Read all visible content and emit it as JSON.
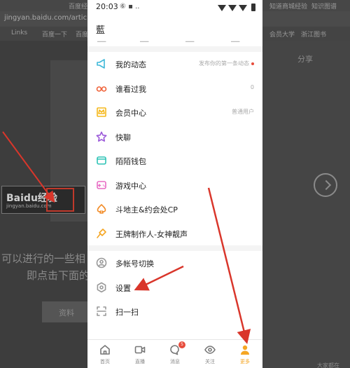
{
  "background_page": {
    "tabs": [
      "百度经验-让...",
      "知道商城经验",
      "知识图谱"
    ],
    "url": "jingyan.baidu.com/article/",
    "bookmarks": [
      "Links",
      "百度一下",
      "百度",
      "会员大学",
      "浙江图书"
    ],
    "logo_text": "Baidu经验",
    "logo_sub": "jingyan.baidu.com",
    "left_text_1": "可以进行的一些相",
    "left_text_2": "即点击下面的设",
    "bottom_left_text": "资料",
    "right_panel_text": "分享",
    "bottom_right_text": "大家都在"
  },
  "status_bar": {
    "time": "20:03",
    "left_icons": "⑥ ▪ .."
  },
  "profile": {
    "username": "藍"
  },
  "menu": [
    {
      "label": "我的动态",
      "extra": "发布你的第一条动态",
      "dot": true,
      "icon": "megaphone-icon",
      "color": "#3fb8d9"
    },
    {
      "label": "谁看过我",
      "extra": "0",
      "dot": false,
      "icon": "glasses-icon",
      "color": "#f0643c"
    },
    {
      "label": "会员中心",
      "extra": "普通用户",
      "dot": false,
      "icon": "crown-icon",
      "color": "#f5b81c"
    },
    {
      "label": "快聊",
      "extra": "",
      "dot": false,
      "icon": "star-icon",
      "color": "#9b59d9"
    },
    {
      "label": "陌陌钱包",
      "extra": "",
      "dot": false,
      "icon": "wallet-icon",
      "color": "#2ec4b6"
    },
    {
      "label": "游戏中心",
      "extra": "",
      "dot": false,
      "icon": "gamepad-icon",
      "color": "#e86cc4"
    },
    {
      "label": "斗地主&约会处CP",
      "extra": "",
      "dot": false,
      "icon": "spade-icon",
      "color": "#f28c28"
    },
    {
      "label": "王牌制作人-女神靓声",
      "extra": "",
      "dot": false,
      "icon": "microphone-icon",
      "color": "#f5a623"
    },
    {
      "label": "多帐号切换",
      "extra": "",
      "dot": false,
      "icon": "account-switch-icon",
      "color": "#999999"
    },
    {
      "label": "设置",
      "extra": "",
      "dot": false,
      "icon": "settings-hexagon-icon",
      "color": "#999999"
    },
    {
      "label": "扫一扫",
      "extra": "",
      "dot": false,
      "icon": "scan-icon",
      "color": "#999999"
    }
  ],
  "bottom_nav": [
    {
      "label": "首页",
      "icon": "home-icon",
      "active": false
    },
    {
      "label": "直播",
      "icon": "video-icon",
      "active": false
    },
    {
      "label": "消息",
      "icon": "message-icon",
      "active": false,
      "badge": "5"
    },
    {
      "label": "关注",
      "icon": "eye-icon",
      "active": false
    },
    {
      "label": "更多",
      "icon": "person-icon",
      "active": true
    }
  ],
  "colors": {
    "accent": "#f5a623",
    "arrow": "#d9362b",
    "badge": "#e74c3c"
  }
}
